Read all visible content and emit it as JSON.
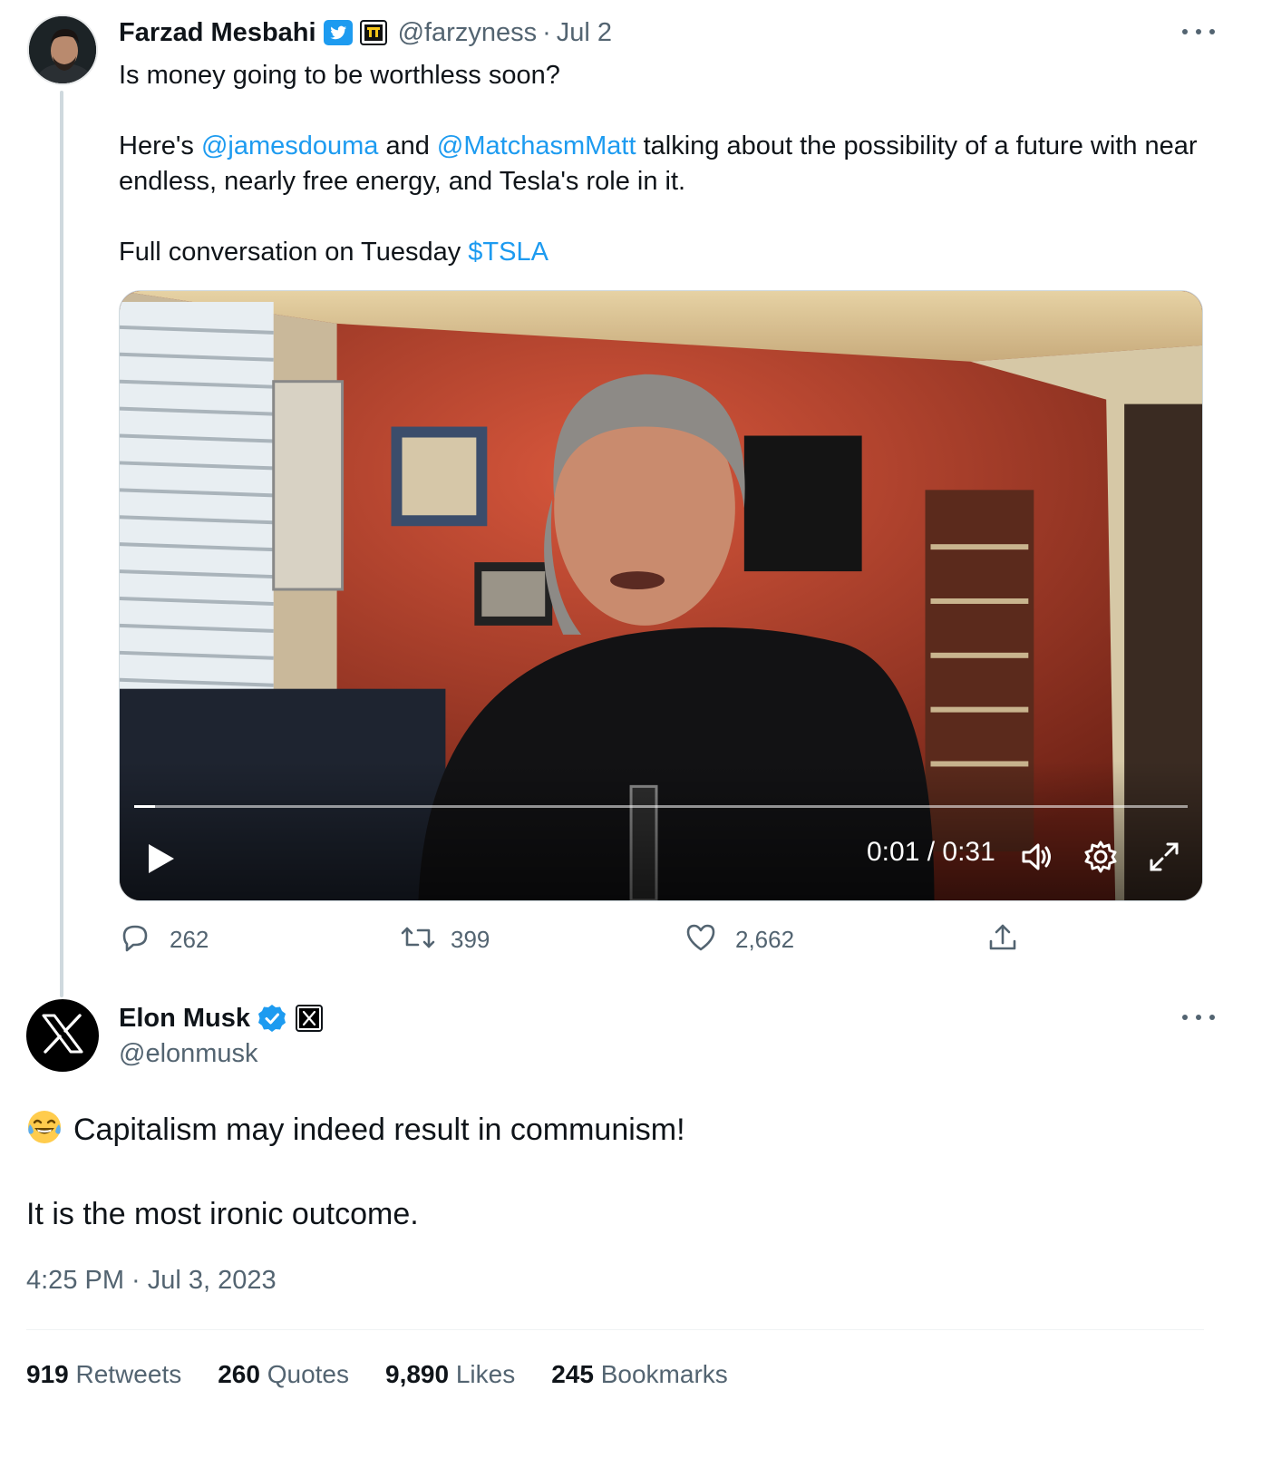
{
  "tweet1": {
    "author": {
      "name": "Farzad Mesbahi",
      "handle": "@farzyness",
      "date": "Jul 2",
      "separator": "·"
    },
    "text": {
      "line1": "Is money going to be worthless soon?",
      "p2_prefix": "Here's ",
      "mention1": "@jamesdouma",
      "p2_mid": " and ",
      "mention2": "@MatchasmMatt",
      "p2_suffix": " talking about the possibility of a future with near endless, nearly free energy, and Tesla's role in it.",
      "p3_prefix": "Full conversation on Tuesday ",
      "cashtag": "$TSLA"
    },
    "video": {
      "timecode": "0:01 / 0:31",
      "progress": 0.02
    },
    "actions": {
      "replies": "262",
      "retweets": "399",
      "likes": "2,662"
    }
  },
  "tweet2": {
    "author": {
      "name": "Elon Musk",
      "handle": "@elonmusk"
    },
    "text": {
      "line1": "Capitalism may indeed result in communism!",
      "line2": "It is the most ironic outcome."
    },
    "timestamp": "4:25 PM · Jul 3, 2023",
    "stats": [
      {
        "value": "919",
        "label": "Retweets"
      },
      {
        "value": "260",
        "label": "Quotes"
      },
      {
        "value": "9,890",
        "label": "Likes"
      },
      {
        "value": "245",
        "label": "Bookmarks"
      }
    ]
  },
  "colors": {
    "link": "#1d9bf0",
    "text": "#0f1419",
    "secondary": "#536471",
    "verified": "#1d9bf0"
  },
  "icons": [
    "more-icon",
    "verified-icon",
    "affiliate-badge-icon",
    "play-icon",
    "volume-icon",
    "settings-icon",
    "fullscreen-icon",
    "reply-icon",
    "retweet-icon",
    "like-icon",
    "share-icon",
    "x-logo-icon",
    "laughing-emoji-icon"
  ]
}
